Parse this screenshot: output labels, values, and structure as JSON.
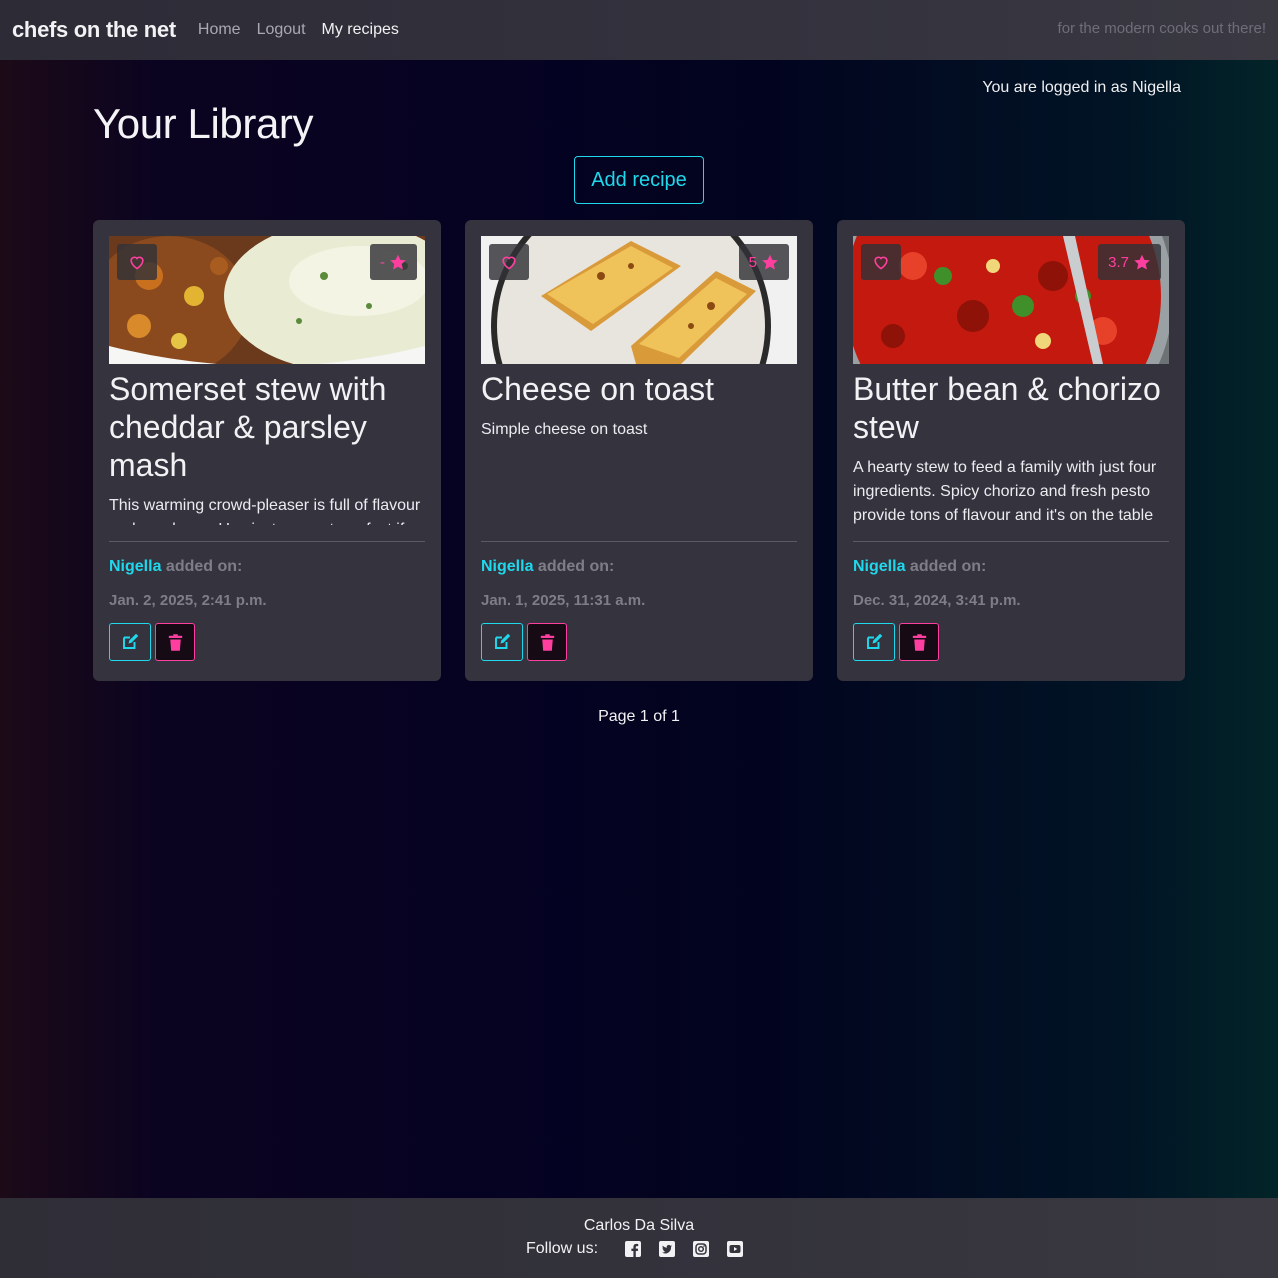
{
  "navbar": {
    "brand": "chefs on the net",
    "links": [
      {
        "label": "Home"
      },
      {
        "label": "Logout"
      },
      {
        "label": "My recipes"
      }
    ],
    "tagline": "for the modern cooks out there!"
  },
  "user": {
    "logged_in_text": "You are logged in as Nigella"
  },
  "page": {
    "title": "Your Library",
    "add_button": "Add recipe"
  },
  "recipes": [
    {
      "title": "Somerset stew with cheddar & parsley mash",
      "description": "This warming crowd-pleaser is full of flavour and goodness. Use just one pot, perfect if",
      "rating": "-",
      "author": "Nigella",
      "added_on_label": "added on:",
      "date": "Jan. 2, 2025, 2:41 p.m.",
      "icons": {
        "favorite": "heart-outline-icon",
        "rating": "star-icon",
        "edit": "edit-icon",
        "delete": "trash-icon"
      }
    },
    {
      "title": "Cheese on toast",
      "description": "Simple cheese on toast",
      "rating": "5",
      "author": "Nigella",
      "added_on_label": "added on:",
      "date": "Jan. 1, 2025, 11:31 a.m.",
      "icons": {
        "favorite": "heart-outline-icon",
        "rating": "star-icon",
        "edit": "edit-icon",
        "delete": "trash-icon"
      }
    },
    {
      "title": "Butter bean & chorizo stew",
      "description": "A hearty stew to feed a family with just four ingredients. Spicy chorizo and fresh pesto provide tons of flavour and it's on the table",
      "rating": "3.7",
      "author": "Nigella",
      "added_on_label": "added on:",
      "date": "Dec. 31, 2024, 3:41 p.m.",
      "icons": {
        "favorite": "heart-outline-icon",
        "rating": "star-icon",
        "edit": "edit-icon",
        "delete": "trash-icon"
      }
    }
  ],
  "pagination": {
    "text": "Page 1 of 1"
  },
  "footer": {
    "name": "Carlos Da Silva",
    "follow_label": "Follow us:",
    "social_icons": [
      "facebook-icon",
      "twitter-icon",
      "instagram-icon",
      "youtube-icon"
    ]
  },
  "colors": {
    "accent_cyan": "#1fd8ec",
    "accent_pink": "#ff3fa0",
    "card_bg": "#34333e"
  }
}
